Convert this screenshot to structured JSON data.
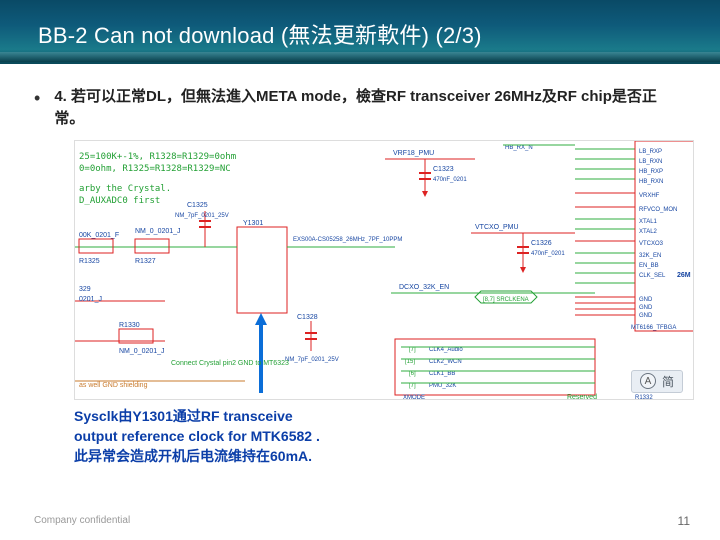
{
  "header": {
    "title": "BB-2 Can not download (無法更新軟件) (2/3)"
  },
  "body": {
    "bullet1": "4. 若可以正常DL，但無法進入META mode，檢查RF transceiver 26MHz及RF chip是否正常。"
  },
  "diagram": {
    "left_text1": "25=100K+-1%, R1328=R1329=0ohm",
    "left_text2": "0=0ohm, R1325=R1328=R1329=NC",
    "left_text3": "arby the Crystal.",
    "left_text4": "D_AUXADC0 first",
    "cap1": "C1325",
    "cap1_val": "NM_7pF_0201_25V",
    "comp_y": "Y1301",
    "xtal_label": "EXS00A-CS05258_26MHz_7PF_10PPM",
    "res1": "R1325",
    "res2": "R1327",
    "res3": "R1330",
    "nm_label": "NM_0_0201_J",
    "nm_label2": "NM_0_0201_J",
    "k100": "00K_0201_F",
    "c1328": "C1328",
    "c1328v": "NM_7pF_0201_25V",
    "vrf18": "VRF18_PMU",
    "c1323": "C1323",
    "c1323v": "470nF_0201",
    "vtcxo": "VTCXO_PMU",
    "dcxo": "DCXO_32K_EN",
    "srclkena": "[8,7] SRCLKENA",
    "c1326": "C1326",
    "c1326v": "470nF_0201",
    "hb_rx_n": "HB_RX_N",
    "right": {
      "lb_rxp": "LB_RXP",
      "lb_rxn": "LB_RXN",
      "hb_rxp": "HB_RXP",
      "hb_rxn": "HB_RXN",
      "vrxhf": "VRXHF",
      "rfvco": "RFVCO_MON",
      "xtal1": "XTAL1",
      "xtal2": "XTAL2",
      "vtcxo3": "VTCXO3",
      "en32k": "32K_EN",
      "en_bb": "EN_BB",
      "clk_sel": "CLK_SEL",
      "m26": "26M",
      "gnd": "GND",
      "mt6166": "MT6166_TFBGA"
    },
    "bottom_conn": {
      "clk4": "CLK4_Audio",
      "clk2": "CLK2_WCN",
      "clk1": "CLK1_BB",
      "pmu": "PMU_32K",
      "xmode": "XMODE"
    },
    "connect_note1": "Connect Crystal pin2 GND to MT6323",
    "connect_note2": "as well GND shielding",
    "reserved": "Reserved",
    "r1332": "R1332"
  },
  "note": {
    "line1": "Sysclk由Y1301通过RF transceive",
    "line2": "output reference clock for MTK6582 .",
    "line3": "此异常会造成开机后电流维持在60mA."
  },
  "footer": {
    "conf": "Company confidential",
    "page": "11"
  },
  "lang": {
    "letter": "A",
    "label": "简"
  }
}
